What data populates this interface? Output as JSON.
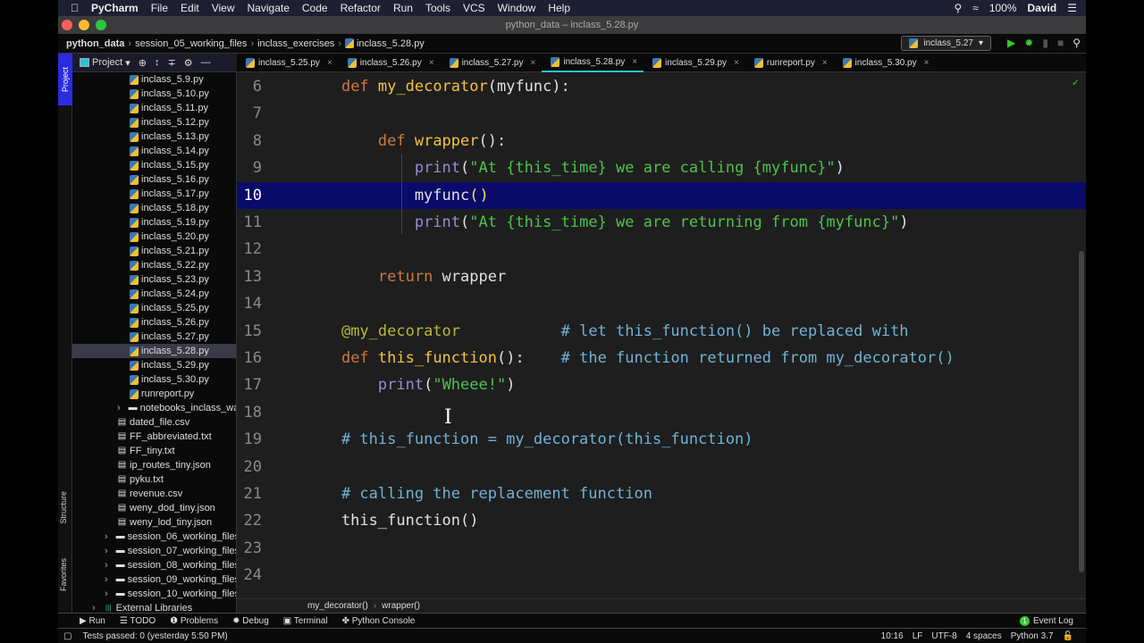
{
  "menubar": {
    "app": "PyCharm",
    "items": [
      "File",
      "Edit",
      "View",
      "Navigate",
      "Code",
      "Refactor",
      "Run",
      "Tools",
      "VCS",
      "Window",
      "Help"
    ],
    "battery": "100%",
    "user": "David"
  },
  "window_title": "python_data – inclass_5.28.py",
  "nav": {
    "crumbs": [
      "python_data",
      "session_05_working_files",
      "inclass_exercises",
      "inclass_5.28.py"
    ],
    "run_config": "inclass_5.27"
  },
  "project": {
    "label": "Project",
    "side_labels": {
      "project": "Project",
      "structure": "Structure",
      "favorites": "Favorites"
    },
    "tree": [
      {
        "name": "inclass_5.9.py",
        "type": "py",
        "depth": 3
      },
      {
        "name": "inclass_5.10.py",
        "type": "py",
        "depth": 3
      },
      {
        "name": "inclass_5.11.py",
        "type": "py",
        "depth": 3
      },
      {
        "name": "inclass_5.12.py",
        "type": "py",
        "depth": 3
      },
      {
        "name": "inclass_5.13.py",
        "type": "py",
        "depth": 3
      },
      {
        "name": "inclass_5.14.py",
        "type": "py",
        "depth": 3
      },
      {
        "name": "inclass_5.15.py",
        "type": "py",
        "depth": 3
      },
      {
        "name": "inclass_5.16.py",
        "type": "py",
        "depth": 3
      },
      {
        "name": "inclass_5.17.py",
        "type": "py",
        "depth": 3
      },
      {
        "name": "inclass_5.18.py",
        "type": "py",
        "depth": 3
      },
      {
        "name": "inclass_5.19.py",
        "type": "py",
        "depth": 3
      },
      {
        "name": "inclass_5.20.py",
        "type": "py",
        "depth": 3
      },
      {
        "name": "inclass_5.21.py",
        "type": "py",
        "depth": 3
      },
      {
        "name": "inclass_5.22.py",
        "type": "py",
        "depth": 3
      },
      {
        "name": "inclass_5.23.py",
        "type": "py",
        "depth": 3
      },
      {
        "name": "inclass_5.24.py",
        "type": "py",
        "depth": 3
      },
      {
        "name": "inclass_5.25.py",
        "type": "py",
        "depth": 3
      },
      {
        "name": "inclass_5.26.py",
        "type": "py",
        "depth": 3
      },
      {
        "name": "inclass_5.27.py",
        "type": "py",
        "depth": 3
      },
      {
        "name": "inclass_5.28.py",
        "type": "py",
        "depth": 3,
        "selected": true
      },
      {
        "name": "inclass_5.29.py",
        "type": "py",
        "depth": 3
      },
      {
        "name": "inclass_5.30.py",
        "type": "py",
        "depth": 3
      },
      {
        "name": "runreport.py",
        "type": "py",
        "depth": 3
      },
      {
        "name": "notebooks_inclass_warm",
        "type": "folder",
        "depth": 2
      },
      {
        "name": "dated_file.csv",
        "type": "file",
        "depth": 2
      },
      {
        "name": "FF_abbreviated.txt",
        "type": "file",
        "depth": 2
      },
      {
        "name": "FF_tiny.txt",
        "type": "file",
        "depth": 2
      },
      {
        "name": "ip_routes_tiny.json",
        "type": "file",
        "depth": 2
      },
      {
        "name": "pyku.txt",
        "type": "file",
        "depth": 2
      },
      {
        "name": "revenue.csv",
        "type": "file",
        "depth": 2
      },
      {
        "name": "weny_dod_tiny.json",
        "type": "file",
        "depth": 2
      },
      {
        "name": "weny_lod_tiny.json",
        "type": "file",
        "depth": 2
      },
      {
        "name": "session_06_working_files",
        "type": "folder",
        "depth": 1
      },
      {
        "name": "session_07_working_files",
        "type": "folder",
        "depth": 1
      },
      {
        "name": "session_08_working_files",
        "type": "folder",
        "depth": 1
      },
      {
        "name": "session_09_working_files",
        "type": "folder",
        "depth": 1
      },
      {
        "name": "session_10_working_files",
        "type": "folder",
        "depth": 1
      },
      {
        "name": "External Libraries",
        "type": "lib",
        "depth": 0
      }
    ]
  },
  "tabs": [
    {
      "label": "inclass_5.25.py"
    },
    {
      "label": "inclass_5.26.py"
    },
    {
      "label": "inclass_5.27.py"
    },
    {
      "label": "inclass_5.28.py",
      "active": true
    },
    {
      "label": "inclass_5.29.py"
    },
    {
      "label": "runreport.py"
    },
    {
      "label": "inclass_5.30.py"
    }
  ],
  "code": [
    {
      "n": "6",
      "t": [
        [
          "pl",
          "    "
        ],
        [
          "kw",
          "def "
        ],
        [
          "fn",
          "my_decorator"
        ],
        [
          "pl",
          "(myfunc):"
        ]
      ]
    },
    {
      "n": "7",
      "t": []
    },
    {
      "n": "8",
      "t": [
        [
          "pl",
          "        "
        ],
        [
          "kw",
          "def "
        ],
        [
          "fn",
          "wrapper"
        ],
        [
          "pl",
          "():"
        ]
      ]
    },
    {
      "n": "9",
      "t": [
        [
          "pl",
          "            "
        ],
        [
          "bi",
          "print"
        ],
        [
          "pl",
          "("
        ],
        [
          "st",
          "\"At {this_time} we are calling {myfunc}\""
        ],
        [
          "pl",
          ")"
        ]
      ]
    },
    {
      "n": "10",
      "cur": true,
      "t": [
        [
          "pl",
          "            myfunc"
        ],
        [
          "br",
          "("
        ],
        [
          "pl",
          "|"
        ],
        [
          "br",
          ")"
        ]
      ]
    },
    {
      "n": "11",
      "t": [
        [
          "pl",
          "            "
        ],
        [
          "bi",
          "print"
        ],
        [
          "pl",
          "("
        ],
        [
          "st",
          "\"At {this_time} we are returning from {myfunc}\""
        ],
        [
          "pl",
          ")"
        ]
      ]
    },
    {
      "n": "12",
      "t": []
    },
    {
      "n": "13",
      "t": [
        [
          "pl",
          "        "
        ],
        [
          "kw",
          "return "
        ],
        [
          "pl",
          "wrapper"
        ]
      ]
    },
    {
      "n": "14",
      "t": []
    },
    {
      "n": "15",
      "t": [
        [
          "pl",
          "    "
        ],
        [
          "dc",
          "@my_decorator"
        ],
        [
          "pl",
          "           "
        ],
        [
          "cm",
          "# let this_function() be replaced with"
        ]
      ]
    },
    {
      "n": "16",
      "t": [
        [
          "pl",
          "    "
        ],
        [
          "kw",
          "def "
        ],
        [
          "fn",
          "this_function"
        ],
        [
          "pl",
          "():    "
        ],
        [
          "cm",
          "# the function returned from my_decorator()"
        ]
      ]
    },
    {
      "n": "17",
      "t": [
        [
          "pl",
          "        "
        ],
        [
          "bi",
          "print"
        ],
        [
          "pl",
          "("
        ],
        [
          "st",
          "\"Wheee!\""
        ],
        [
          "pl",
          ")"
        ]
      ]
    },
    {
      "n": "18",
      "t": []
    },
    {
      "n": "19",
      "t": [
        [
          "pl",
          "    "
        ],
        [
          "cm",
          "# this_function = my_decorator(this_function)"
        ]
      ]
    },
    {
      "n": "20",
      "t": []
    },
    {
      "n": "21",
      "t": [
        [
          "pl",
          "    "
        ],
        [
          "cm",
          "# calling the replacement function"
        ]
      ]
    },
    {
      "n": "22",
      "t": [
        [
          "pl",
          "    this_function()"
        ]
      ]
    },
    {
      "n": "23",
      "t": []
    },
    {
      "n": "24",
      "t": []
    }
  ],
  "editor_breadcrumb": [
    "my_decorator()",
    "wrapper()"
  ],
  "toolwindows": [
    "Run",
    "TODO",
    "Problems",
    "Debug",
    "Terminal",
    "Python Console"
  ],
  "event_log": {
    "label": "Event Log",
    "count": "1"
  },
  "status": {
    "message": "Tests passed: 0 (yesterday 5:50 PM)",
    "position": "10:16",
    "line_sep": "LF",
    "encoding": "UTF-8",
    "indent": "4 spaces",
    "interpreter": "Python 3.7"
  },
  "colors": {
    "selection_line": "#0a0a6a",
    "accent_tab": "#2bc3d3",
    "project_strip": "#2b2be0"
  }
}
